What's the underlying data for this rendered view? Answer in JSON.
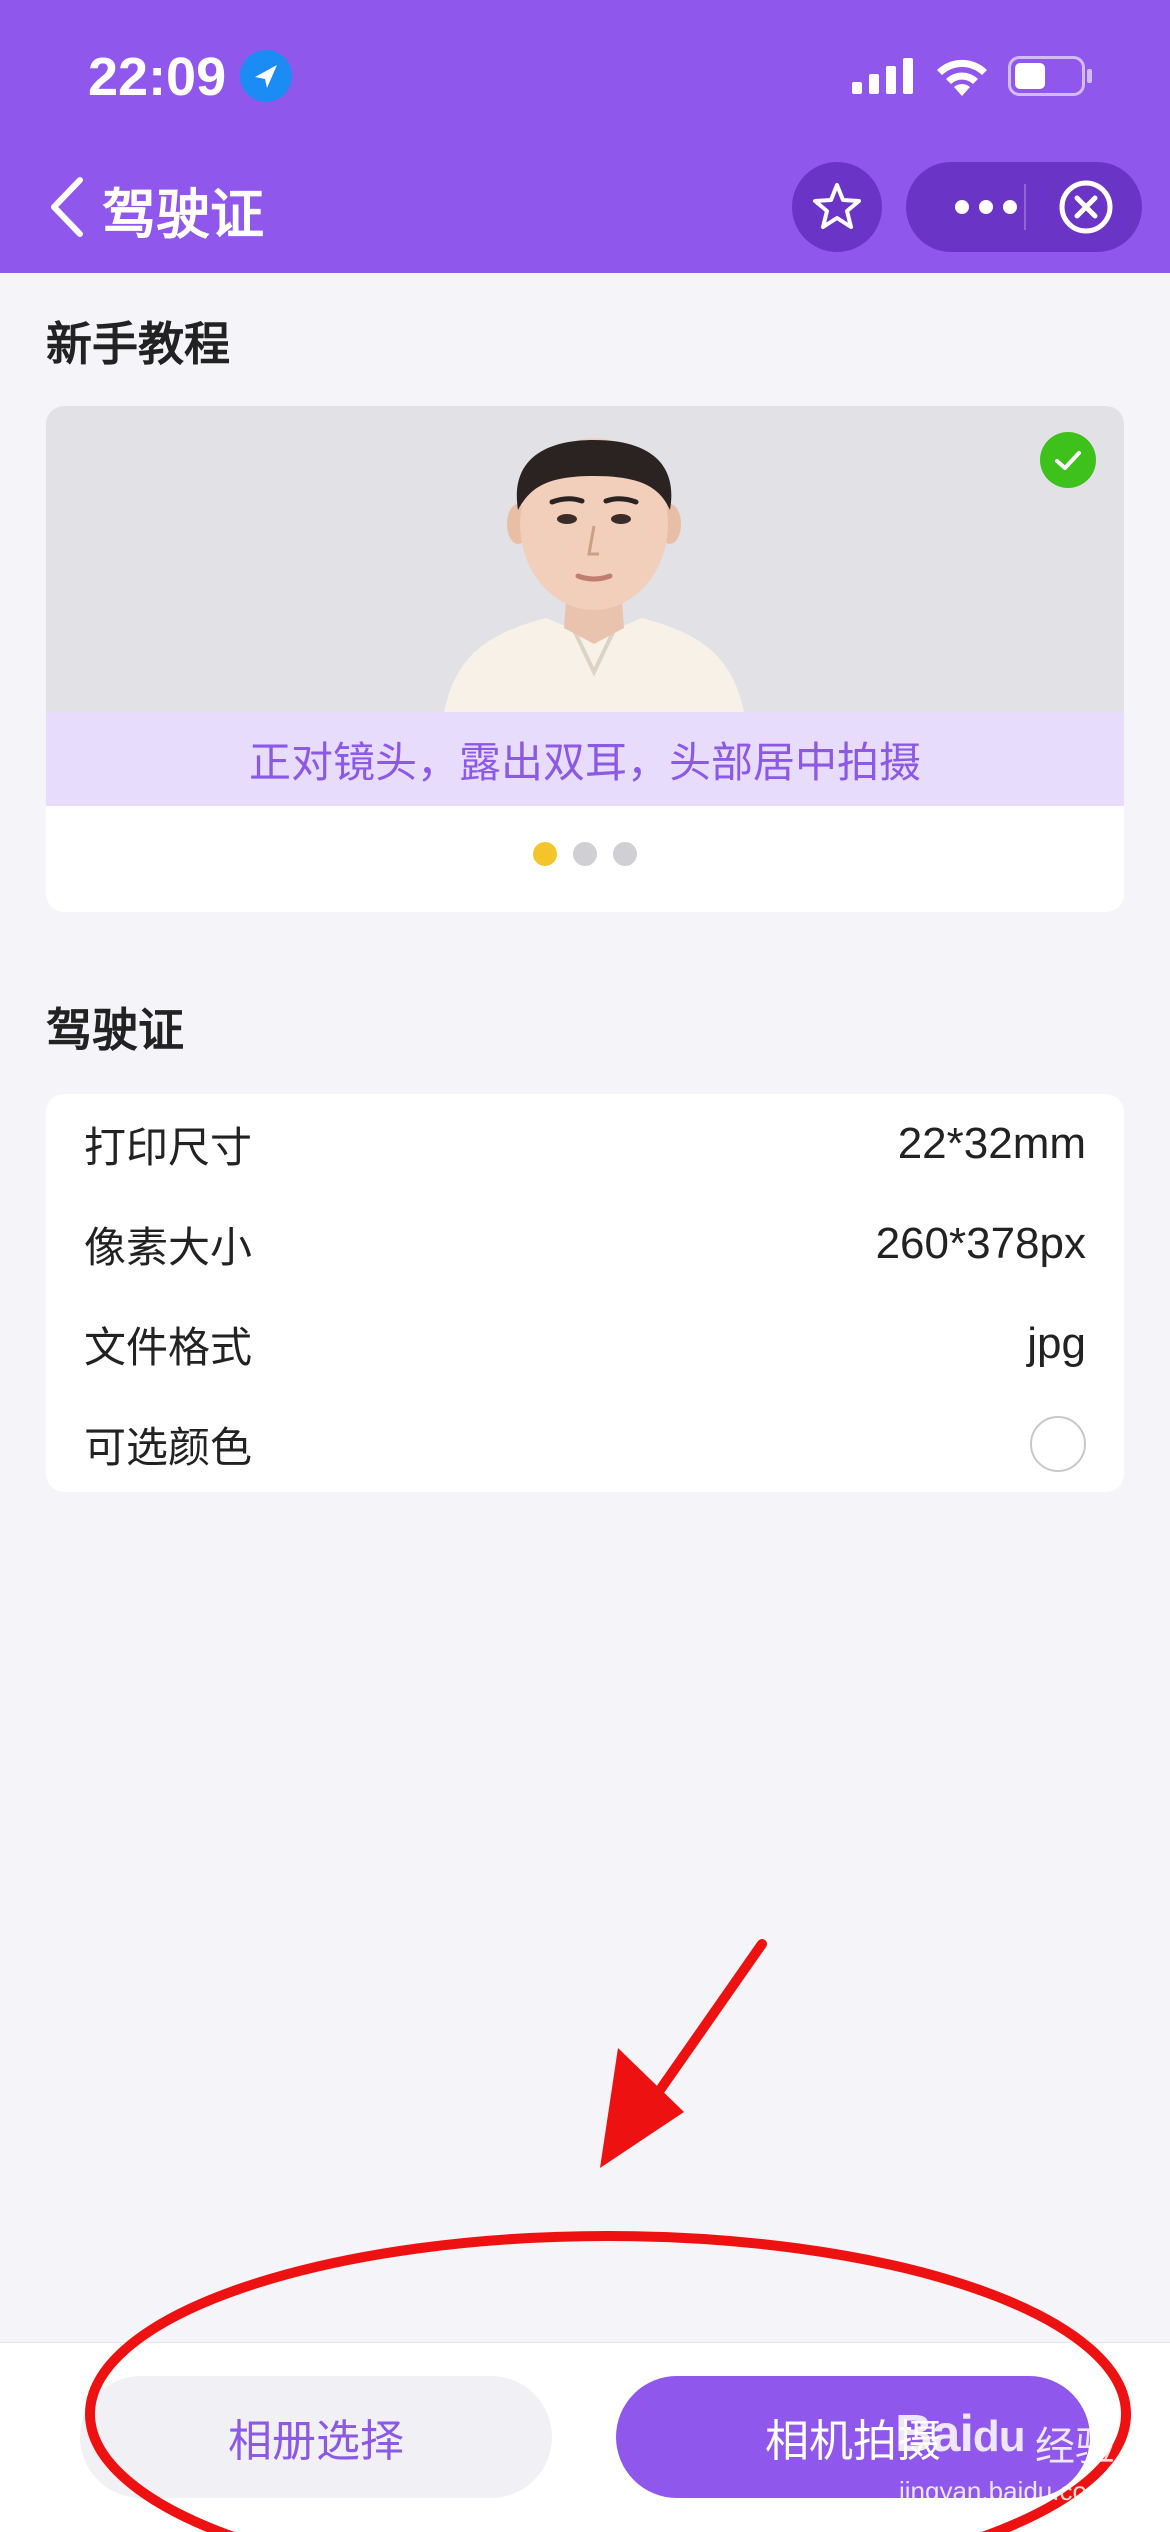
{
  "status_bar": {
    "time": "22:09",
    "icons": [
      "location-arrow-icon",
      "cellular-signal-icon",
      "wifi-icon",
      "battery-icon"
    ]
  },
  "nav": {
    "title": "驾驶证",
    "back_icon": "chevron-left-icon",
    "favorite_icon": "star-icon",
    "more_icon": "more-dots-icon",
    "close_icon": "close-circle-icon"
  },
  "tutorial": {
    "heading": "新手教程",
    "caption": "正对镜头，露出双耳，头部居中拍摄",
    "carousel_count": 3,
    "carousel_active": 1
  },
  "spec": {
    "heading": "驾驶证",
    "rows": [
      {
        "label": "打印尺寸",
        "value": "22*32mm"
      },
      {
        "label": "像素大小",
        "value": "260*378px"
      },
      {
        "label": "文件格式",
        "value": "jpg"
      },
      {
        "label": "可选颜色",
        "value": ""
      }
    ]
  },
  "actions": {
    "album_label": "相册选择",
    "camera_label": "相机拍摄"
  },
  "watermark": {
    "logo_bai": "Bai",
    "logo_du": "du",
    "logo_cn": "经验",
    "url": "jingyan.baidu.com"
  },
  "colors": {
    "brand_purple": "#8f57ec",
    "capsule_purple": "#6a34c6",
    "caption_bg": "#e7dcfc",
    "check_green": "#3fc11c",
    "dot_active": "#f4c52a",
    "annotation_red": "#ee1111"
  }
}
